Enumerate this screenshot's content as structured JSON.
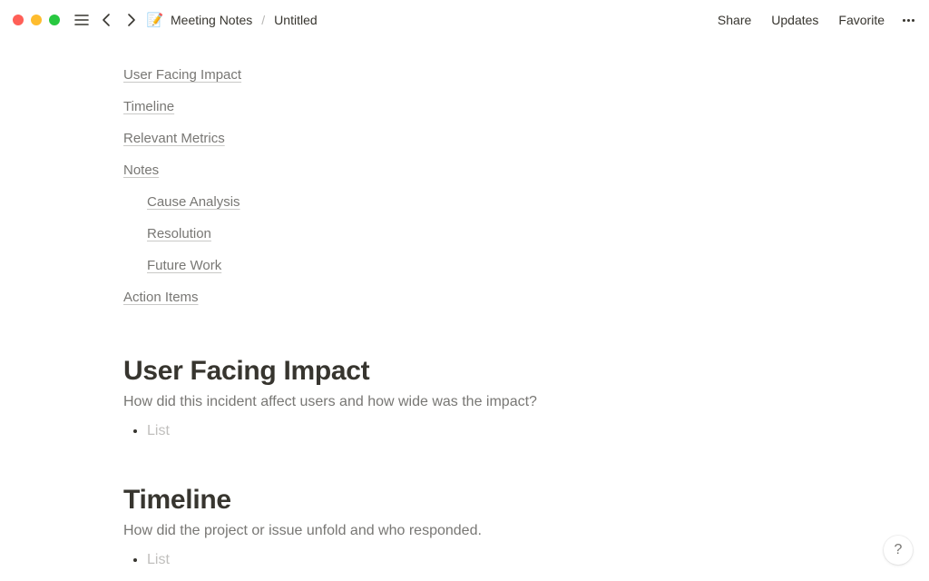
{
  "window": {
    "breadcrumb": {
      "parent": "Meeting Notes",
      "current": "Untitled"
    },
    "actions": {
      "share": "Share",
      "updates": "Updates",
      "favorite": "Favorite"
    }
  },
  "toc": {
    "items": [
      {
        "label": "User Facing Impact",
        "indent": 0
      },
      {
        "label": "Timeline",
        "indent": 0
      },
      {
        "label": "Relevant Metrics",
        "indent": 0
      },
      {
        "label": "Notes",
        "indent": 0
      },
      {
        "label": "Cause Analysis",
        "indent": 1
      },
      {
        "label": "Resolution",
        "indent": 1
      },
      {
        "label": "Future Work",
        "indent": 1
      },
      {
        "label": "Action Items",
        "indent": 0
      }
    ]
  },
  "sections": [
    {
      "title": "User Facing Impact",
      "desc": "How did this incident affect users and how wide was the impact?",
      "list_placeholder": "List"
    },
    {
      "title": "Timeline",
      "desc": "How did the project or issue unfold and who responded.",
      "list_placeholder": "List"
    }
  ],
  "help": {
    "glyph": "?"
  },
  "page_emoji": "📝"
}
